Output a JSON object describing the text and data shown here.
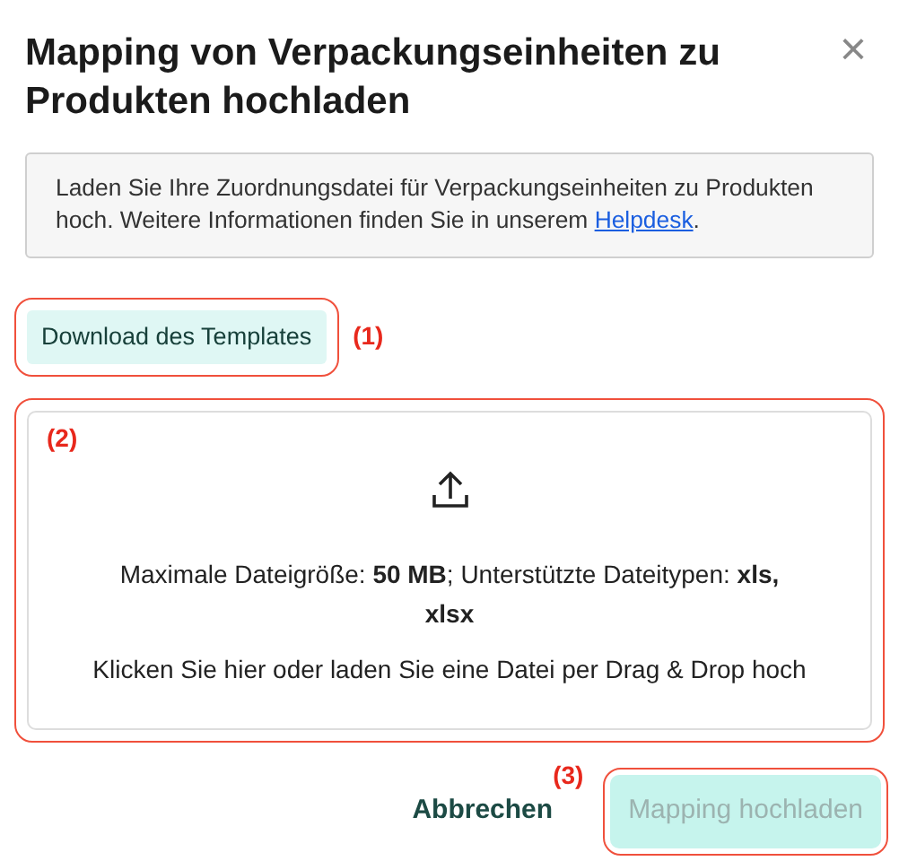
{
  "dialog": {
    "title": "Mapping von Verpackungseinheiten zu Produkten hochladen",
    "close": "×"
  },
  "info": {
    "text": "Laden Sie Ihre Zuordnungsdatei für Verpackungseinheiten zu Produkten hoch. Weitere Informationen finden Sie in unserem ",
    "link": "Helpdesk",
    "after": "."
  },
  "template_button": {
    "label": "Download des Templates",
    "annotation": "(1)"
  },
  "dropzone": {
    "annotation": "(2)",
    "limits": "Maximale Dateigröße: **50 MB**; Unterstützte Dateitypen: **xls, xlsx**",
    "hint": "Klicken Sie hier oder laden Sie eine Datei per Drag & Drop hoch"
  },
  "footer": {
    "cancel": "Abbrechen",
    "submit": {
      "label": "Mapping hochladen",
      "disabled": true,
      "annotation": "(3)"
    }
  }
}
